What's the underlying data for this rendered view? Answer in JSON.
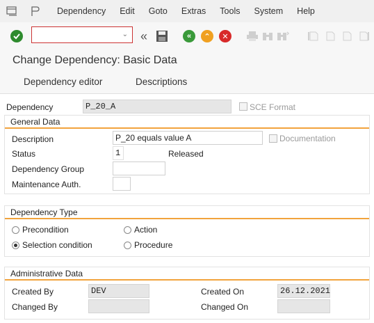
{
  "menubar": {
    "items": [
      {
        "label": "Dependency"
      },
      {
        "label": "Edit"
      },
      {
        "label": "Goto"
      },
      {
        "label": "Extras"
      },
      {
        "label": "Tools"
      },
      {
        "label": "System"
      },
      {
        "label": "Help"
      }
    ]
  },
  "toolbar": {
    "command_value": "",
    "icons": [
      "enter-icon",
      "back-arrows-icon",
      "save-icon",
      "back-icon",
      "exit-icon",
      "cancel-icon",
      "print-icon",
      "find-icon",
      "find-next-icon",
      "first-page-icon",
      "prev-page-icon",
      "next-page-icon",
      "last-page-icon"
    ],
    "colors": {
      "enter": "#2e8b2e",
      "back": "#3a9a3a",
      "exit": "#f0a020",
      "cancel": "#d82a2a"
    }
  },
  "header": {
    "title": "Change Dependency: Basic Data"
  },
  "tabs": [
    {
      "label": "Dependency editor"
    },
    {
      "label": "Descriptions"
    }
  ],
  "dependency": {
    "label": "Dependency",
    "value": "P_20_A",
    "sce_format_label": "SCE Format"
  },
  "general_data": {
    "title": "General Data",
    "description_label": "Description",
    "description_value": "P_20 equals value A",
    "documentation_label": "Documentation",
    "status_label": "Status",
    "status_value": "1",
    "status_text": "Released",
    "dependency_group_label": "Dependency Group",
    "dependency_group_value": "",
    "maintenance_auth_label": "Maintenance Auth.",
    "maintenance_auth_value": ""
  },
  "dependency_type": {
    "title": "Dependency Type",
    "options": [
      {
        "label": "Precondition",
        "selected": false
      },
      {
        "label": "Action",
        "selected": false
      },
      {
        "label": "Selection condition",
        "selected": true
      },
      {
        "label": "Procedure",
        "selected": false
      }
    ]
  },
  "admin_data": {
    "title": "Administrative Data",
    "created_by_label": "Created By",
    "created_by_value": "DEV",
    "created_on_label": "Created On",
    "created_on_value": "26.12.2021",
    "changed_by_label": "Changed By",
    "changed_by_value": "",
    "changed_on_label": "Changed On",
    "changed_on_value": ""
  },
  "accent_color": "#f2a33c"
}
